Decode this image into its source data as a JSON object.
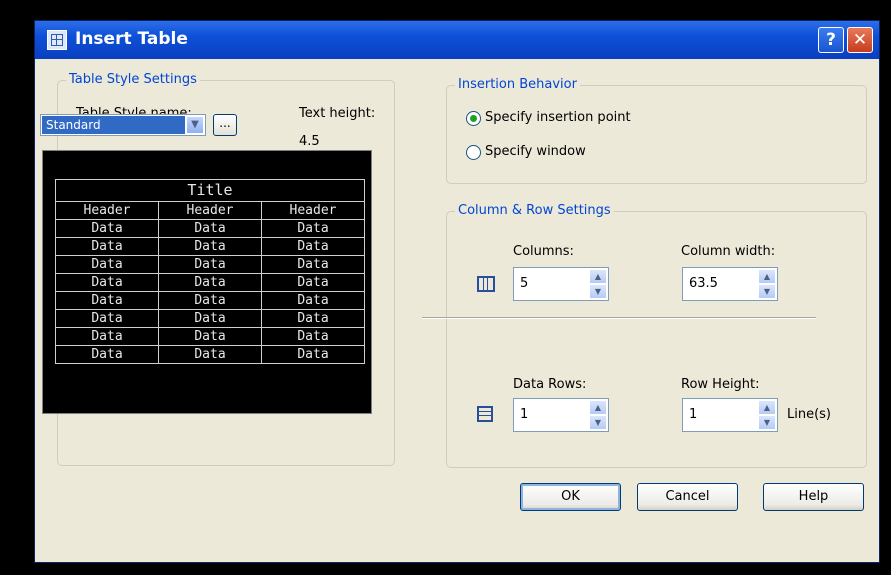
{
  "window": {
    "title": "Insert Table",
    "help_glyph": "?",
    "close_glyph": "✕"
  },
  "table_style": {
    "group_title": "Table Style Settings",
    "name_label": "Table Style name:",
    "name_value": "Standard",
    "browse_label": "...",
    "text_height_label": "Text height:",
    "text_height_value": "4.5",
    "preview": {
      "title": "Title",
      "headers": [
        "Header",
        "Header",
        "Header"
      ],
      "cell": "Data",
      "data_rows": 8
    }
  },
  "insertion": {
    "group_title": "Insertion Behavior",
    "options": [
      {
        "label": "Specify insertion point",
        "selected": true
      },
      {
        "label": "Specify window",
        "selected": false
      }
    ]
  },
  "col_row": {
    "group_title": "Column & Row Settings",
    "columns_label": "Columns:",
    "columns_value": "5",
    "column_width_label": "Column width:",
    "column_width_value": "63.5",
    "data_rows_label": "Data Rows:",
    "data_rows_value": "1",
    "row_height_label": "Row Height:",
    "row_height_value": "1",
    "row_height_unit": "Line(s)"
  },
  "buttons": {
    "ok": "OK",
    "cancel": "Cancel",
    "help": "Help"
  },
  "colors": {
    "titlebar": "#0d50d8",
    "group_title": "#0046d5",
    "dialog_bg": "#ece9d8"
  }
}
